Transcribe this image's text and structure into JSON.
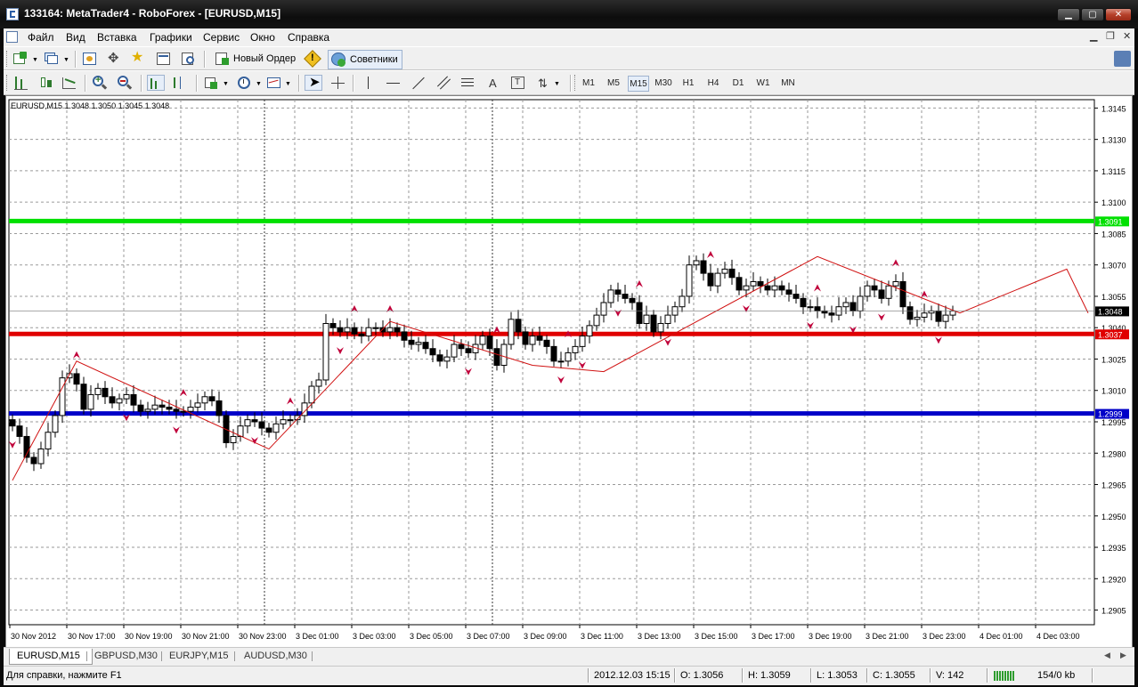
{
  "window": {
    "title": "133164: MetaTrader4 - RoboForex - [EURUSD,M15]"
  },
  "menu": [
    "Файл",
    "Вид",
    "Вставка",
    "Графики",
    "Сервис",
    "Окно",
    "Справка"
  ],
  "toolbar": {
    "new_order": "Новый Ордер",
    "experts": "Советники"
  },
  "timeframes": [
    "M1",
    "M5",
    "M15",
    "M30",
    "H1",
    "H4",
    "D1",
    "W1",
    "MN"
  ],
  "active_timeframe": "M15",
  "chart": {
    "header": "EURUSD,M15  1.3048 1.3050 1.3045 1.3048"
  },
  "chart_data": {
    "type": "candlestick",
    "symbol": "EURUSD",
    "timeframe": "M15",
    "ylim": [
      1.2898,
      1.3149
    ],
    "y_ticks": [
      "1.3145",
      "1.3130",
      "1.3115",
      "1.3100",
      "1.3085",
      "1.3070",
      "1.3055",
      "1.3040",
      "1.3025",
      "1.3010",
      "1.2995",
      "1.2980",
      "1.2965",
      "1.2950",
      "1.2935",
      "1.2920",
      "1.2905"
    ],
    "x_ticks": [
      "30 Nov 2012",
      "30 Nov 17:00",
      "30 Nov 19:00",
      "30 Nov 21:00",
      "30 Nov 23:00",
      "3 Dec 01:00",
      "3 Dec 03:00",
      "3 Dec 05:00",
      "3 Dec 07:00",
      "3 Dec 09:00",
      "3 Dec 11:00",
      "3 Dec 13:00",
      "3 Dec 15:00",
      "3 Dec 17:00",
      "3 Dec 19:00",
      "3 Dec 21:00",
      "3 Dec 23:00",
      "4 Dec 01:00",
      "4 Dec 03:00"
    ],
    "current_price": 1.3048,
    "horizontal_lines": [
      {
        "price": 1.3091,
        "color": "#00e000",
        "label": "1.3091"
      },
      {
        "price": 1.3037,
        "color": "#e00000",
        "label": "1.3037"
      },
      {
        "price": 1.2999,
        "color": "#0000c8",
        "label": "1.2999"
      }
    ],
    "current_price_label": "1.3048",
    "close": [
      1.2993,
      1.2988,
      1.2978,
      1.2975,
      1.2982,
      1.299,
      1.2998,
      1.3016,
      1.3018,
      1.3013,
      1.3001,
      1.3008,
      1.3011,
      1.3007,
      1.3004,
      1.3006,
      1.3008,
      1.3003,
      1.3,
      1.3001,
      1.3003,
      1.3002,
      1.3001,
      1.3,
      1.3,
      1.3002,
      1.3004,
      1.3007,
      1.3005,
      1.2998,
      1.2985,
      1.2988,
      1.2993,
      1.2996,
      1.2995,
      1.2992,
      1.299,
      1.2994,
      1.2996,
      1.2996,
      1.2998,
      1.3004,
      1.3012,
      1.3015,
      1.3042,
      1.304,
      1.3038,
      1.304,
      1.3037,
      1.3036,
      1.304,
      1.304,
      1.3038,
      1.304,
      1.3038,
      1.3034,
      1.3032,
      1.3033,
      1.303,
      1.3027,
      1.3024,
      1.3026,
      1.3032,
      1.303,
      1.3028,
      1.3032,
      1.3036,
      1.303,
      1.3022,
      1.3032,
      1.3044,
      1.3038,
      1.3032,
      1.3036,
      1.3034,
      1.3031,
      1.3024,
      1.3024,
      1.3028,
      1.3031,
      1.3036,
      1.3041,
      1.3046,
      1.3052,
      1.3058,
      1.3056,
      1.3054,
      1.3052,
      1.3042,
      1.3046,
      1.3038,
      1.3042,
      1.3046,
      1.305,
      1.3055,
      1.307,
      1.3072,
      1.3066,
      1.306,
      1.3066,
      1.3068,
      1.3064,
      1.3058,
      1.306,
      1.3062,
      1.306,
      1.3058,
      1.306,
      1.3058,
      1.3056,
      1.3054,
      1.305,
      1.305,
      1.3048,
      1.3047,
      1.3046,
      1.305,
      1.3052,
      1.3048,
      1.3055,
      1.306,
      1.3058,
      1.3054,
      1.306,
      1.3062,
      1.305,
      1.3044,
      1.3045,
      1.3047,
      1.3048,
      1.3043,
      1.3046,
      1.3048
    ],
    "zigzag": [
      [
        0,
        1.2967
      ],
      [
        9,
        1.3024
      ],
      [
        36,
        1.2982
      ],
      [
        53,
        1.3043
      ],
      [
        73,
        1.3022
      ],
      [
        83,
        1.3019
      ],
      [
        113,
        1.3074
      ],
      [
        133,
        1.3047
      ],
      [
        148,
        1.3068
      ],
      [
        151,
        1.3047
      ]
    ],
    "fractals_up": [
      9,
      24,
      39,
      48,
      53,
      68,
      78,
      88,
      98,
      113,
      124,
      128,
      137,
      143,
      146,
      148,
      155,
      161,
      172,
      179
    ],
    "fractals_down": [
      0,
      16,
      23,
      34,
      46,
      64,
      77,
      80,
      85,
      92,
      103,
      112,
      118,
      122,
      130,
      136,
      140,
      151,
      157,
      162,
      170,
      175
    ]
  },
  "tabs": [
    "EURUSD,M15",
    "GBPUSD,M30",
    "EURJPY,M15",
    "AUDUSD,M30"
  ],
  "status": {
    "help": "Для справки, нажмите F1",
    "datetime": "2012.12.03 15:15",
    "open": "O: 1.3056",
    "high": "H: 1.3059",
    "low": "L: 1.3053",
    "close": "C: 1.3055",
    "volume": "V: 142",
    "traffic": "154/0 kb"
  }
}
